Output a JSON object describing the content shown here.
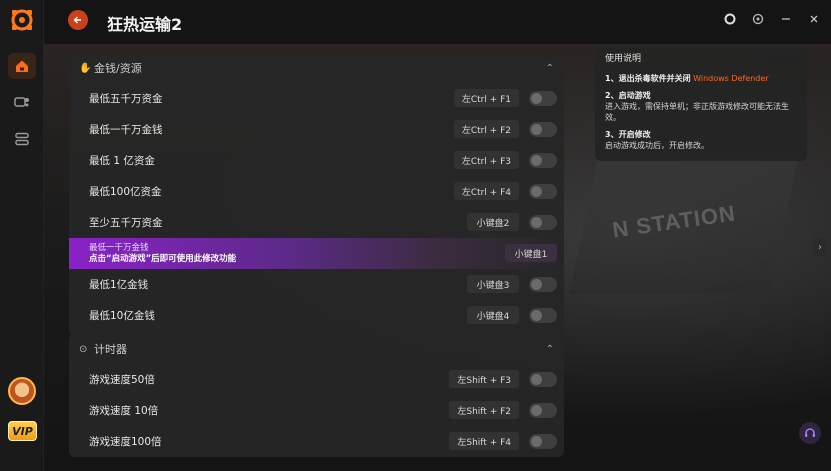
{
  "app": {
    "title": "狂热运输2"
  },
  "sidebar": {
    "vip_label": "VIP"
  },
  "money_section": {
    "title": "金钱/资源",
    "rows": [
      {
        "label": "最低五千万资金",
        "hotkey": "左Ctrl + F1"
      },
      {
        "label": "最低一千万金钱",
        "hotkey": "左Ctrl + F2"
      },
      {
        "label": "最低 1 亿资金",
        "hotkey": "左Ctrl + F3"
      },
      {
        "label": "最低100亿资金",
        "hotkey": "左Ctrl + F4"
      },
      {
        "label": "至少五千万资金",
        "hotkey": "小键盘2"
      },
      {
        "label": "最低一千万金钱",
        "sublabel": "点击“启动游戏”后即可使用此修改功能",
        "hotkey": "小键盘1"
      },
      {
        "label": "最低1亿金钱",
        "hotkey": "小键盘3"
      },
      {
        "label": "最低10亿金钱",
        "hotkey": "小键盘4"
      }
    ]
  },
  "timer_section": {
    "title": "计时器",
    "rows": [
      {
        "label": "游戏速度50倍",
        "hotkey": "左Shift + F3"
      },
      {
        "label": "游戏速度 10倍",
        "hotkey": "左Shift + F2"
      },
      {
        "label": "游戏速度100倍",
        "hotkey": "左Shift + F4"
      }
    ]
  },
  "instructions": {
    "title": "使用说明",
    "step1_title": "1、退出杀毒软件并关闭",
    "step1_highlight": "Windows Defender",
    "step2_title": "2、启动游戏",
    "step2_text": "进入游戏，需保持单机；非正版游戏修改可能无法生效。",
    "step3_title": "3、开启修改",
    "step3_text": "启动游戏成功后，开启修改。"
  },
  "background_sign": "N STATION",
  "colors": {
    "accent": "#c7421a",
    "highlight_purple": "#8a22c8",
    "orange_text": "#ff6a1f"
  }
}
